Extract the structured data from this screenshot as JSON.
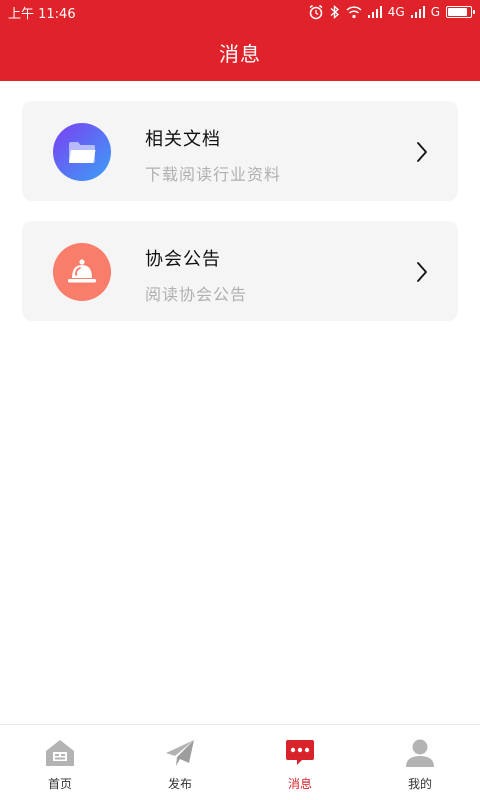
{
  "status": {
    "time": "上午 11:46",
    "network_label": "4G",
    "network2_label": "G",
    "battery_level": 0.85
  },
  "header": {
    "title": "消息"
  },
  "cards": [
    {
      "title": "相关文档",
      "subtitle": "下载阅读行业资料",
      "icon": "folder-icon"
    },
    {
      "title": "协会公告",
      "subtitle": "阅读协会公告",
      "icon": "bell-icon"
    }
  ],
  "tabbar": {
    "active": "消息",
    "items": [
      {
        "label": "首页",
        "icon": "home-icon"
      },
      {
        "label": "发布",
        "icon": "paper-plane-icon"
      },
      {
        "label": "消息",
        "icon": "chat-icon"
      },
      {
        "label": "我的",
        "icon": "user-icon"
      }
    ]
  },
  "colors": {
    "brand": "#e0232a",
    "active_tab": "#d9232a",
    "inactive_icon": "#b3b3b3"
  }
}
